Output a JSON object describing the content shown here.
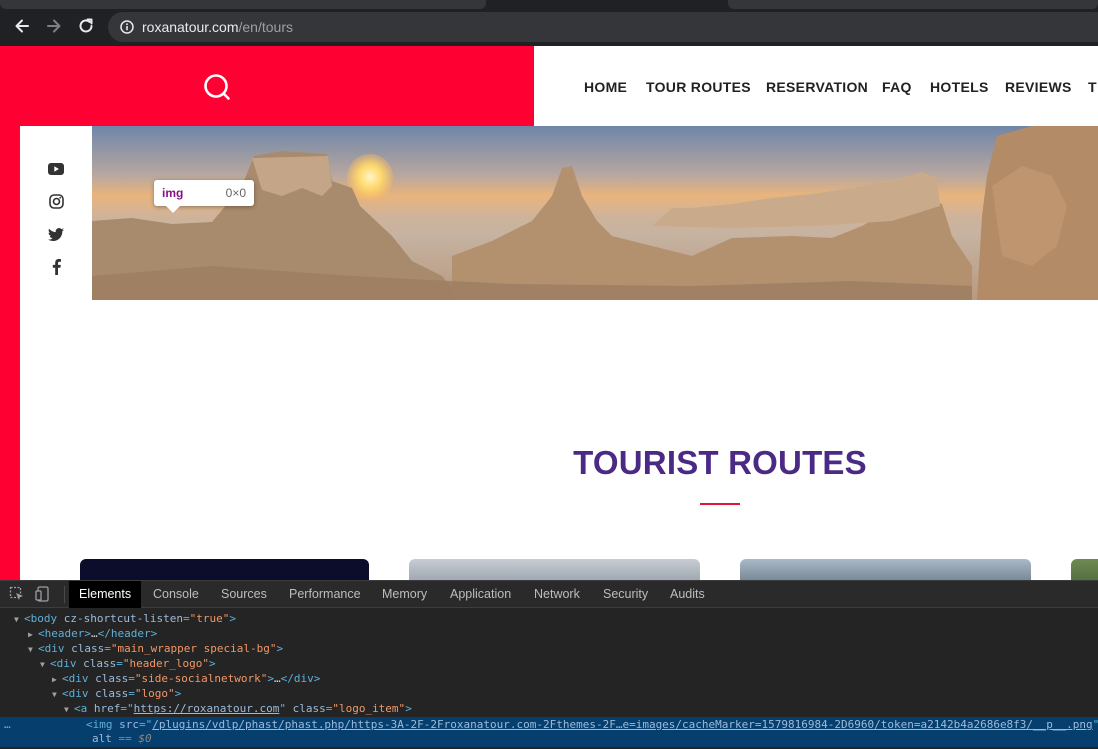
{
  "browser": {
    "url_domain": "roxanatour.com",
    "url_path": "/en/tours"
  },
  "site": {
    "nav": [
      "HOME",
      "TOUR ROUTES",
      "RESERVATION",
      "FAQ",
      "HOTELS",
      "REVIEWS",
      "T"
    ],
    "social_icons": [
      "youtube-icon",
      "instagram-icon",
      "twitter-icon",
      "facebook-icon"
    ],
    "section_title": "TOURIST ROUTES",
    "colors": {
      "brand_red": "#ff0033",
      "title_purple": "#4b2a86",
      "accent_line": "#e0173a"
    }
  },
  "inspector_tooltip": {
    "tag": "img",
    "size": "0×0"
  },
  "devtools": {
    "tabs": [
      "Elements",
      "Console",
      "Sources",
      "Performance",
      "Memory",
      "Application",
      "Network",
      "Security",
      "Audits"
    ],
    "active_tab": "Elements",
    "dom": {
      "l1_tag_open": "<body",
      "l1_attr": "cz-shortcut-listen",
      "l1_val": "\"true\"",
      "l1_close": ">",
      "l2": "<header>",
      "l2_text": "…",
      "l2_end": "</header>",
      "l3_tag": "<div",
      "l3_attr": "class",
      "l3_val": "\"main_wrapper special-bg\"",
      "l4_val": "\"header_logo\"",
      "l5_val": "\"side-socialnetwork\"",
      "l5_end": "</div>",
      "l6_val": "\"logo\"",
      "l7_tag": "<a",
      "l7_attr1": "href",
      "l7_link": "https://roxanatour.com",
      "l7_attr2": "class",
      "l7_val2": "\"logo_item\"",
      "l8_tag": "<img",
      "l8_attr": "src",
      "l8_link": "/plugins/vdlp/phast/phast.php/https-3A-2F-2Froxanatour.com-2Fthemes-2F…e=images/cacheMarker=1579816984-2D6960/token=a2142b4a2686e8f3/__p__.png",
      "l9_attr": "alt",
      "l9_eq": " == $0",
      "dots": "…"
    }
  }
}
